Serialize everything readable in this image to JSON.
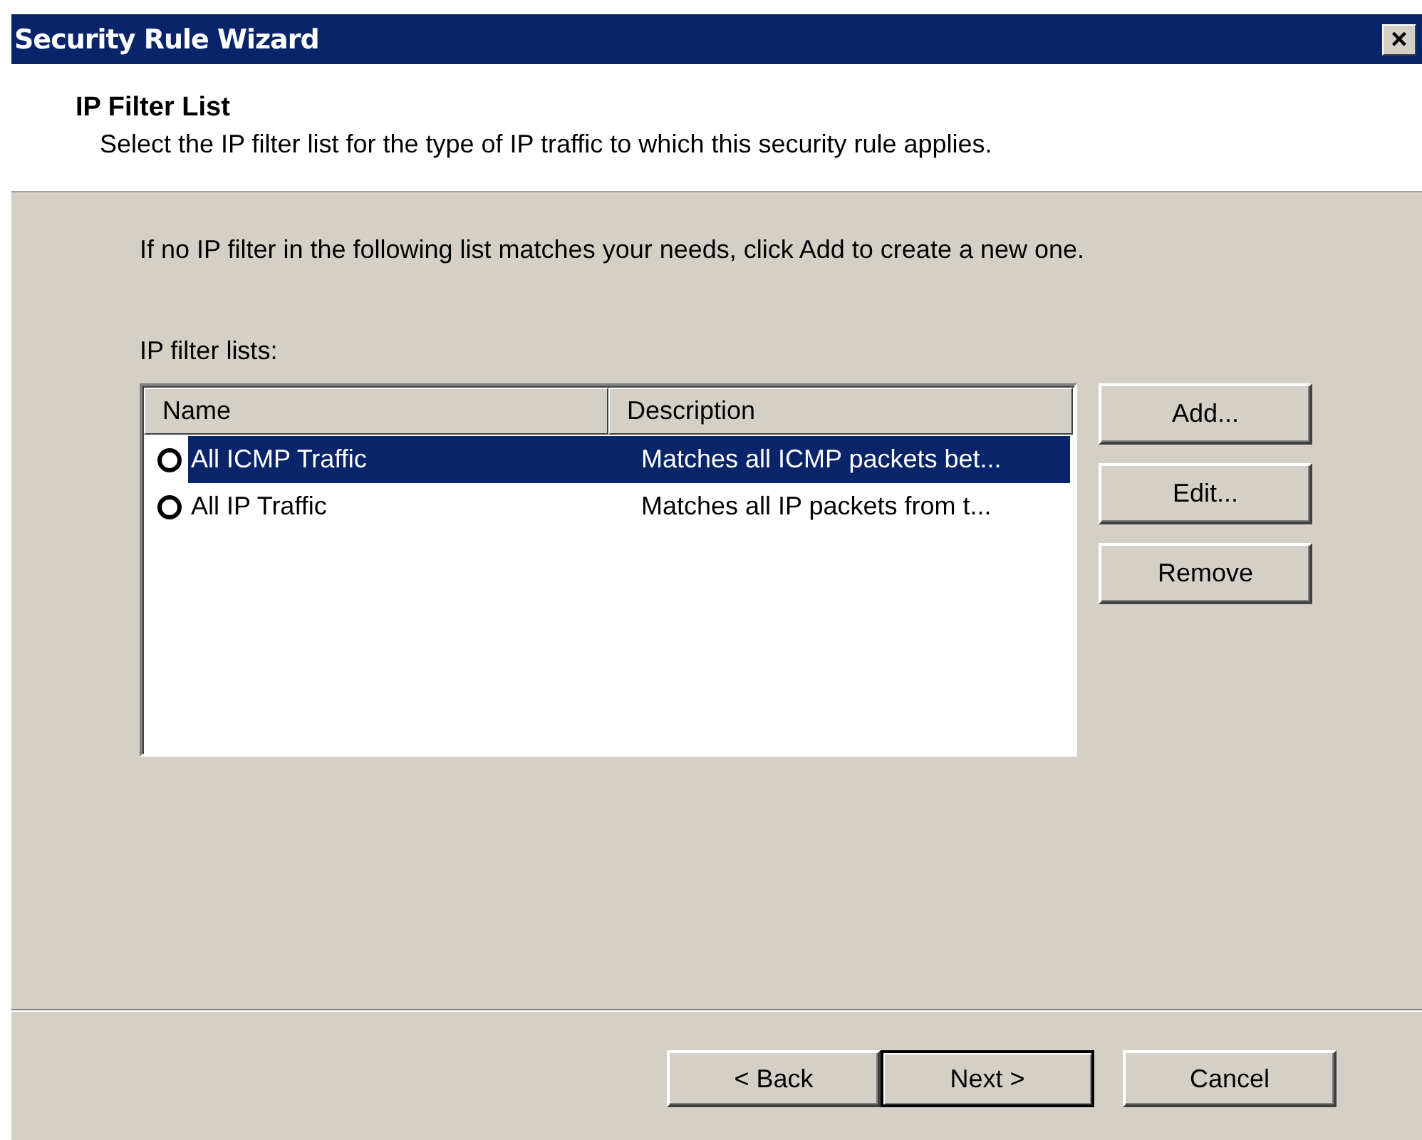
{
  "window": {
    "title": "Security Rule Wizard",
    "close": "×"
  },
  "header": {
    "title": "IP Filter List",
    "subtitle": "Select the IP filter list for the type of IP traffic to which this security rule applies."
  },
  "instruction": "If no IP filter in the following list matches your needs, click Add to create a new one.",
  "list_label": "IP filter lists:",
  "table": {
    "columns": [
      "Name",
      "Description"
    ],
    "rows": [
      {
        "name": "All ICMP Traffic",
        "description": "Matches all ICMP packets bet...",
        "selected": true
      },
      {
        "name": "All IP Traffic",
        "description": "Matches all IP packets from t...",
        "selected": false
      }
    ]
  },
  "side_buttons": [
    "Add...",
    "Edit...",
    "Remove"
  ],
  "buttons": [
    {
      "label": "< Back",
      "default": false
    },
    {
      "label": "Next >",
      "default": true
    },
    {
      "label": "Cancel",
      "default": false
    }
  ]
}
